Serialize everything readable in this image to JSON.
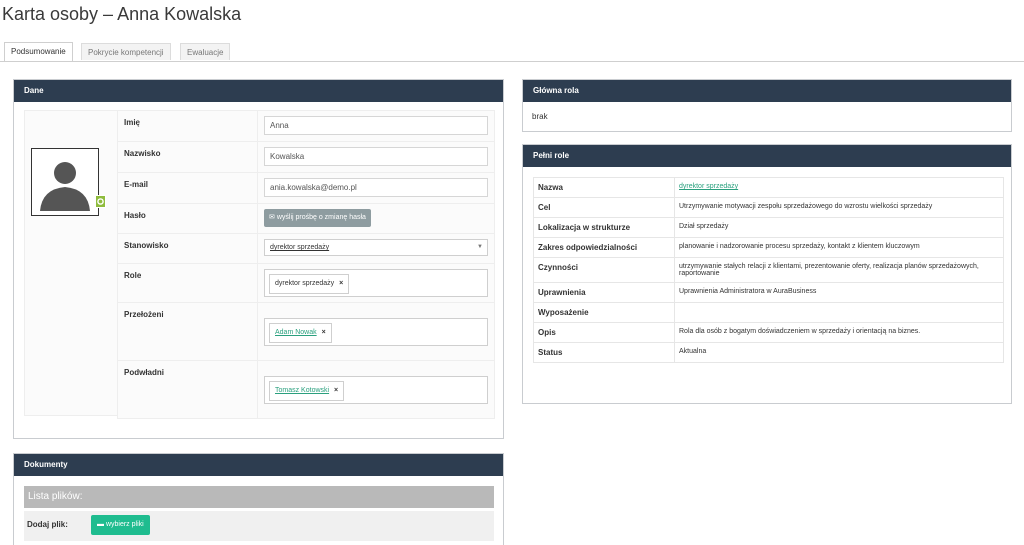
{
  "page_title": "Karta osoby – Anna Kowalska",
  "tabs": [
    {
      "label": "Podsumowanie",
      "active": true
    },
    {
      "label": "Pokrycie kompetencji",
      "active": false
    },
    {
      "label": "Ewaluacje",
      "active": false
    }
  ],
  "dane": {
    "header": "Dane",
    "fields": {
      "imie": {
        "label": "Imię",
        "value": "Anna"
      },
      "nazwisko": {
        "label": "Nazwisko",
        "value": "Kowalska"
      },
      "email": {
        "label": "E-mail",
        "value": "ania.kowalska@demo.pl"
      },
      "haslo": {
        "label": "Hasło",
        "button": "wyślij prośbę o zmianę hasła",
        "icon": "envelope-icon"
      },
      "stanowisko": {
        "label": "Stanowisko",
        "value": "dyrektor sprzedaży"
      },
      "role": {
        "label": "Role",
        "tag": "dyrektor sprzedaży"
      },
      "przelozeni": {
        "label": "Przełożeni",
        "tag": "Adam Nowak"
      },
      "podwladni": {
        "label": "Podwładni",
        "tag": "Tomasz Kotowski"
      }
    },
    "tag_remove_glyph": "×"
  },
  "glowna_rola": {
    "header": "Główna rola",
    "value": "brak"
  },
  "pelni_role": {
    "header": "Pełni role",
    "rows": [
      {
        "key": "Nazwa",
        "value": "dyrektor sprzedaży",
        "link": true
      },
      {
        "key": "Cel",
        "value": "Utrzymywanie motywacji zespołu sprzedażowego do wzrostu wielkości sprzedaży"
      },
      {
        "key": "Lokalizacja w strukturze",
        "value": "Dział sprzedaży"
      },
      {
        "key": "Zakres odpowiedzialności",
        "value": "planowanie i nadzorowanie procesu sprzedaży, kontakt z klientem kluczowym"
      },
      {
        "key": "Czynności",
        "value": "utrzymywanie stałych relacji z klientami, prezentowanie oferty, realizacja planów sprzedażowych, raportowanie"
      },
      {
        "key": "Uprawnienia",
        "value": "Uprawnienia Administratora w AuraBusiness"
      },
      {
        "key": "Wyposażenie",
        "value": ""
      },
      {
        "key": "Opis",
        "value": "Rola dla osób z bogatym doświadczeniem w sprzedaży i orientacją na biznes."
      },
      {
        "key": "Status",
        "value": "Aktualna"
      }
    ]
  },
  "dokumenty": {
    "header": "Dokumenty",
    "files_title": "Lista plików:",
    "add_label": "Dodaj plik:",
    "choose_button": "wybierz pliki",
    "icon": "folder-icon"
  },
  "colors": {
    "panel_header": "#2d3d50",
    "accent_green": "#1fbc8f",
    "link_green": "#2aa07e",
    "button_gray": "#8e9ca0",
    "badge_green": "#8fbc3e"
  }
}
